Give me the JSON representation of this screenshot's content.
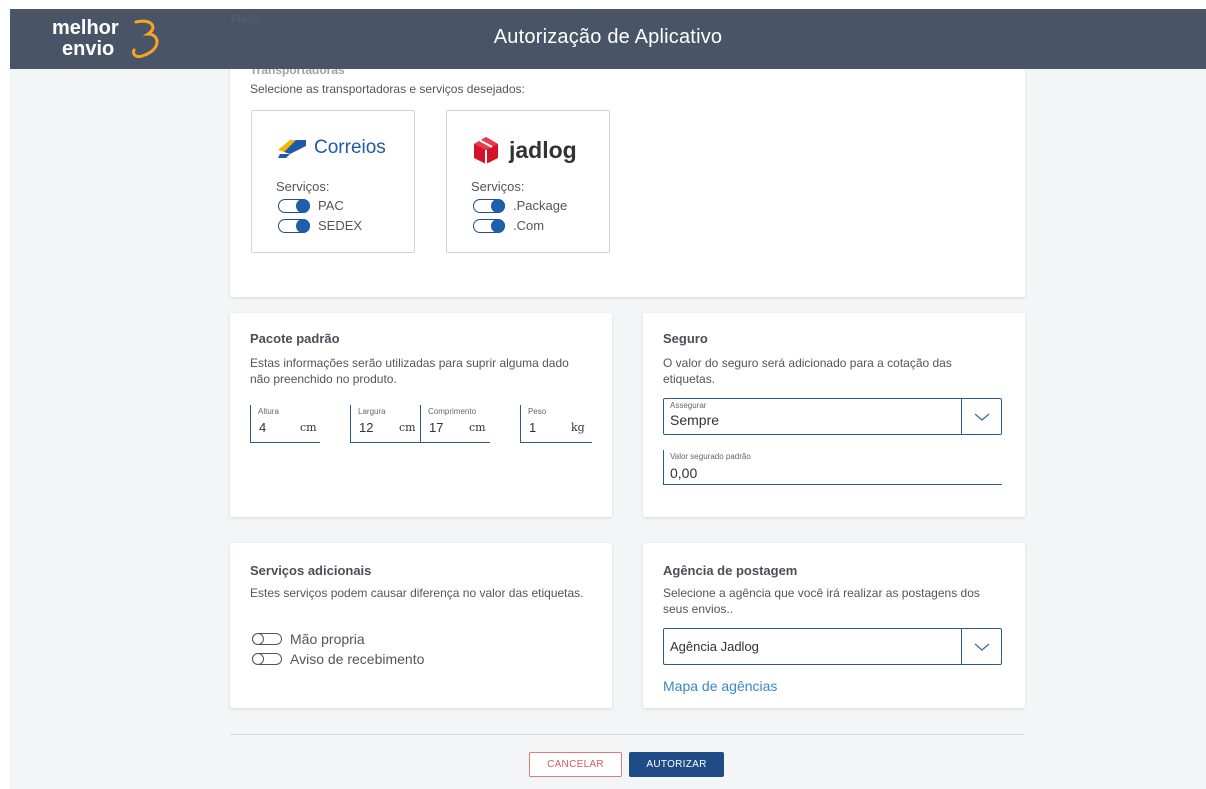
{
  "header": {
    "title": "Autorização de Aplicativo",
    "logo_top": "melhor",
    "logo_bottom": "envio"
  },
  "faded_section": "Frete",
  "carriers_card": {
    "title": "Transportadoras",
    "description": "Selecione as transportadoras e serviços desejados:",
    "carriers": [
      {
        "name": "Correios",
        "services_label": "Serviços:",
        "services": [
          {
            "label": "PAC",
            "enabled": true
          },
          {
            "label": "SEDEX",
            "enabled": true
          }
        ]
      },
      {
        "name": "jadlog",
        "services_label": "Serviços:",
        "services": [
          {
            "label": ".Package",
            "enabled": true
          },
          {
            "label": ".Com",
            "enabled": true
          }
        ]
      }
    ]
  },
  "package_card": {
    "title": "Pacote padrão",
    "description": "Estas informações serão utilizadas para suprir alguma dado não preenchido no produto.",
    "fields": [
      {
        "label": "Altura",
        "value": "4",
        "unit": "cm"
      },
      {
        "label": "Largura",
        "value": "12",
        "unit": "cm"
      },
      {
        "label": "Comprimento",
        "value": "17",
        "unit": "cm"
      },
      {
        "label": "Peso",
        "value": "1",
        "unit": "kg"
      }
    ]
  },
  "insurance_card": {
    "title": "Seguro",
    "description": "O valor do seguro será adicionado para a cotação das etiquetas.",
    "assure_label": "Assegurar",
    "assure_value": "Sempre",
    "default_value_label": "Valor segurado padrão",
    "default_value": "0,00"
  },
  "additional_card": {
    "title": "Serviços adicionais",
    "description": "Estes serviços podem causar diferença no valor das etiquetas.",
    "options": [
      {
        "label": "Mão propria",
        "enabled": false
      },
      {
        "label": "Aviso de recebimento",
        "enabled": false
      }
    ]
  },
  "agency_card": {
    "title": "Agência de postagem",
    "description": "Selecione a agência que você irá realizar as postagens dos seus envios..",
    "selected": "Agência Jadlog",
    "map_link": "Mapa de agências"
  },
  "actions": {
    "cancel": "CANCELAR",
    "authorize": "AUTORIZAR"
  },
  "colors": {
    "header": "#495566",
    "primary": "#1f4b87",
    "link": "#3a87c8",
    "cancel": "#d25b5b",
    "logo_accent": "#f5a623",
    "jadlog_red": "#d4122a"
  }
}
